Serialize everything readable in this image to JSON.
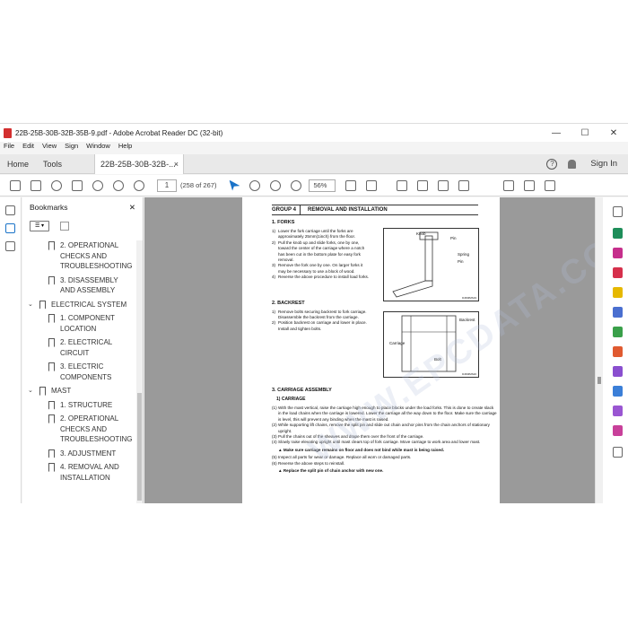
{
  "window": {
    "title": "22B-25B-30B-32B-35B-9.pdf - Adobe Acrobat Reader DC (32-bit)",
    "minimize": "—",
    "maximize": "☐",
    "close": "✕"
  },
  "menu": [
    "File",
    "Edit",
    "View",
    "Sign",
    "Window",
    "Help"
  ],
  "tabs": {
    "home": "Home",
    "tools": "Tools",
    "doc": "22B-25B-30B-32B-...",
    "close": "×",
    "help": "?",
    "sign_in": "Sign In"
  },
  "toolbar": {
    "page_current": "1",
    "page_count": "(258 of 267)",
    "zoom": "56%"
  },
  "bookmarks": {
    "title": "Bookmarks",
    "close": "✕",
    "options": "☰ ▾",
    "items": [
      {
        "level": 2,
        "label": "2. OPERATIONAL CHECKS AND TROUBLESHOOTING"
      },
      {
        "level": 2,
        "label": "3. DISASSEMBLY AND ASSEMBLY"
      },
      {
        "level": 1,
        "label": "ELECTRICAL SYSTEM",
        "chevron": "⌄"
      },
      {
        "level": 2,
        "label": "1. COMPONENT LOCATION"
      },
      {
        "level": 2,
        "label": "2. ELECTRICAL CIRCUIT"
      },
      {
        "level": 2,
        "label": "3. ELECTRIC COMPONENTS"
      },
      {
        "level": 1,
        "label": "MAST",
        "chevron": "⌄"
      },
      {
        "level": 2,
        "label": "1. STRUCTURE"
      },
      {
        "level": 2,
        "label": "2. OPERATIONAL CHECKS AND TROUBLESHOOTING"
      },
      {
        "level": 2,
        "label": "3. ADJUSTMENT"
      },
      {
        "level": 2,
        "label": "4. REMOVAL AND INSTALLATION"
      }
    ]
  },
  "page": {
    "group_label": "GROUP",
    "group_num": "4",
    "group_title": "REMOVAL AND INSTALLATION",
    "forks": {
      "heading": "1. FORKS",
      "steps": [
        {
          "n": "1)",
          "t": "Lower the fork carriage until the forks are approximately 25mm(1inch) from the floor."
        },
        {
          "n": "2)",
          "t": "Pull the knob up and slide forks, one by one, toward the center of the carriage where a notch has been cut in the bottom plate for easy fork removal."
        },
        {
          "n": "3)",
          "t": "Remove the fork one by one. On larger forks it may be necessary to use a block of wood."
        },
        {
          "n": "4)",
          "t": "Reverse the above procedure to install load forks."
        }
      ],
      "fig_labels": [
        "Knob",
        "Pin",
        "Spring",
        "Pin"
      ],
      "fig_code": "D4M3MS19"
    },
    "backrest": {
      "heading": "2. BACKREST",
      "steps": [
        {
          "n": "1)",
          "t": "Remove bolts securing backrest to fork carriage. Disassemble the backrest from the carriage."
        },
        {
          "n": "2)",
          "t": "Position backrest on carriage and lower in place. Install and tighten bolts."
        }
      ],
      "fig_labels": [
        "Backrest",
        "Carriage",
        "Bolt"
      ],
      "fig_code": "D4M3MS20"
    },
    "carriage": {
      "heading": "3. CARRIAGE ASSEMBLY",
      "sub": "1) CARRIAGE",
      "steps": [
        {
          "n": "(1)",
          "t": "With the mast vertical, raise the carriage high enough to place blocks under the load forks. This is done to create slack in the load chains when the carriage is lowered. Lower the carriage all the way down to the floor. Make sure the carriage is level, this will prevent any binding when the mast is raised."
        },
        {
          "n": "(2)",
          "t": "While supporting lift chains, remove the split pin and slide out chain anchor pins from the chain anchors of stationary upright."
        },
        {
          "n": "(3)",
          "t": "Pull the chains out of the sheaves and drape them over the front of the carriage."
        },
        {
          "n": "(4)",
          "t": "Slowly raise elevating upright until mast clears top of fork carriage. Move carriage to work area and lower mast."
        }
      ],
      "warn1": "▲ Make sure carriage remains on floor and does not bind while mast is being raised.",
      "steps2": [
        {
          "n": "(5)",
          "t": "Inspect all parts for wear or damage. Replace all worn or damaged parts."
        },
        {
          "n": "(6)",
          "t": "Reverse the above steps to reinstall."
        }
      ],
      "warn2": "▲ Replace the split pin of chain anchor with new one."
    },
    "watermark": "WWW.EPCDATA.COM"
  }
}
